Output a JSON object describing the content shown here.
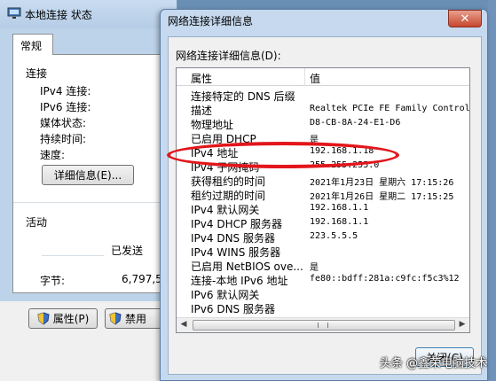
{
  "status_window": {
    "title": "本地连接 状态",
    "tab": "常规",
    "connection_group": "连接",
    "fields": [
      "IPv4 连接:",
      "IPv6 连接:",
      "媒体状态:",
      "持续时间:",
      "速度:"
    ],
    "details_button": "详细信息(E)...",
    "activity_group": "活动",
    "sent_label": "已发送",
    "bytes_label": "字节:",
    "bytes_sent": "6,797,5",
    "properties_button": "属性(P)",
    "disable_button": "禁用"
  },
  "details_window": {
    "title": "网络连接详细信息",
    "close_x": "✕",
    "list_label": "网络连接详细信息(D):",
    "columns": {
      "property": "属性",
      "value": "值"
    },
    "rows": [
      {
        "property": "连接特定的 DNS 后缀",
        "value": ""
      },
      {
        "property": "描述",
        "value": "Realtek PCIe FE Family Control"
      },
      {
        "property": "物理地址",
        "value": "D8-CB-8A-24-E1-D6"
      },
      {
        "property": "已启用 DHCP",
        "value": "是"
      },
      {
        "property": "IPv4 地址",
        "value": "192.168.1.18"
      },
      {
        "property": "IPv4 子网掩码",
        "value": "255.255.255.0"
      },
      {
        "property": "获得租约的时间",
        "value": "2021年1月23日 星期六 17:15:26"
      },
      {
        "property": "租约过期的时间",
        "value": "2021年1月26日 星期二 17:15:25"
      },
      {
        "property": "IPv4 默认网关",
        "value": "192.168.1.1"
      },
      {
        "property": "IPv4 DHCP 服务器",
        "value": "192.168.1.1"
      },
      {
        "property": "IPv4 DNS 服务器",
        "value": "223.5.5.5"
      },
      {
        "property": "IPv4 WINS 服务器",
        "value": ""
      },
      {
        "property": "已启用 NetBIOS ove...",
        "value": "是"
      },
      {
        "property": "连接-本地 IPv6 地址",
        "value": "fe80::bdff:281a:c9fc:f5c3%12"
      },
      {
        "property": "IPv6 默认网关",
        "value": ""
      },
      {
        "property": "IPv6 DNS 服务器",
        "value": ""
      }
    ],
    "close_button": "关闭(C)"
  },
  "watermark": "头条 @鑫荣电脑技术",
  "colors": {
    "highlight_ellipse": "#e2161b",
    "title_close": "#c7472e"
  }
}
